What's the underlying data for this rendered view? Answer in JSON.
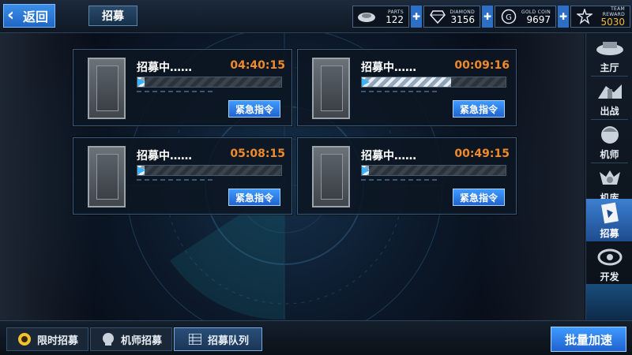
{
  "header": {
    "back_label": "返回",
    "page_title": "招募",
    "resources": [
      {
        "icon": "parts-icon",
        "caption": "PARTS",
        "value": "122"
      },
      {
        "icon": "diamond-icon",
        "caption": "DIAMOND",
        "value": "3156"
      },
      {
        "icon": "gold-coin-icon",
        "caption": "GOLD COIN",
        "value": "9697"
      },
      {
        "icon": "team-reward-icon",
        "caption": "TEAM REWARD",
        "value": "5030"
      }
    ]
  },
  "cards": [
    {
      "status": "招募中……",
      "timer": "04:40:15",
      "progress": 0.05,
      "button": "紧急指令"
    },
    {
      "status": "招募中……",
      "timer": "00:09:16",
      "progress": 0.62,
      "button": "紧急指令"
    },
    {
      "status": "招募中……",
      "timer": "05:08:15",
      "progress": 0.05,
      "button": "紧急指令"
    },
    {
      "status": "招募中……",
      "timer": "00:49:15",
      "progress": 0.05,
      "button": "紧急指令"
    }
  ],
  "sidenav": {
    "items": [
      {
        "label": "主厅",
        "icon": "hall-icon"
      },
      {
        "label": "出战",
        "icon": "battle-icon"
      },
      {
        "label": "机师",
        "icon": "pilot-icon"
      },
      {
        "label": "机库",
        "icon": "hangar-icon"
      },
      {
        "label": "招募",
        "icon": "recruit-icon",
        "active": true
      },
      {
        "label": "开发",
        "icon": "develop-icon"
      }
    ]
  },
  "bottom": {
    "tabs": [
      {
        "label": "限时招募",
        "icon": "limited-recruit-icon"
      },
      {
        "label": "机师招募",
        "icon": "pilot-recruit-icon"
      },
      {
        "label": "招募队列",
        "icon": "queue-list-icon",
        "active": true
      }
    ],
    "batch_label": "批量加速"
  },
  "colors": {
    "accent_blue": "#2f7fe6",
    "timer_orange": "#f08a2a",
    "gold": "#f3b93a"
  }
}
